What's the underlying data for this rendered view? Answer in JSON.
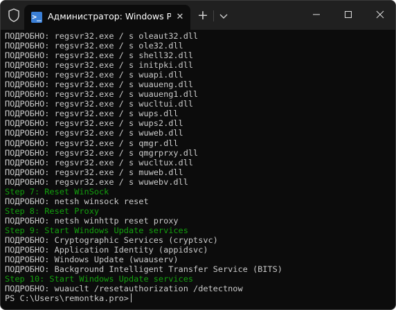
{
  "titlebar": {
    "tab_title": "Администратор: Windows Po",
    "tab_icon_glyph": ">_",
    "close_tab_glyph": "✕",
    "new_tab_glyph": "+",
    "icons": {
      "shield": "shield-icon",
      "tab": "powershell-icon",
      "dropdown": "chevron-down-icon",
      "minimize": "minimize-icon",
      "maximize": "maximize-icon",
      "close": "close-icon"
    }
  },
  "colors": {
    "background": "#0c0c0c",
    "titlebar": "#202020",
    "text": "#cccccc",
    "step_text": "#13a10e"
  },
  "terminal": {
    "lines": [
      {
        "type": "verbose",
        "text": "ПОДРОБНО: regsvr32.exe / s oleaut32.dll"
      },
      {
        "type": "verbose",
        "text": "ПОДРОБНО: regsvr32.exe / s ole32.dll"
      },
      {
        "type": "verbose",
        "text": "ПОДРОБНО: regsvr32.exe / s shell32.dll"
      },
      {
        "type": "verbose",
        "text": "ПОДРОБНО: regsvr32.exe / s initpki.dll"
      },
      {
        "type": "verbose",
        "text": "ПОДРОБНО: regsvr32.exe / s wuapi.dll"
      },
      {
        "type": "verbose",
        "text": "ПОДРОБНО: regsvr32.exe / s wuaueng.dll"
      },
      {
        "type": "verbose",
        "text": "ПОДРОБНО: regsvr32.exe / s wuaueng1.dll"
      },
      {
        "type": "verbose",
        "text": "ПОДРОБНО: regsvr32.exe / s wucltui.dll"
      },
      {
        "type": "verbose",
        "text": "ПОДРОБНО: regsvr32.exe / s wups.dll"
      },
      {
        "type": "verbose",
        "text": "ПОДРОБНО: regsvr32.exe / s wups2.dll"
      },
      {
        "type": "verbose",
        "text": "ПОДРОБНО: regsvr32.exe / s wuweb.dll"
      },
      {
        "type": "verbose",
        "text": "ПОДРОБНО: regsvr32.exe / s qmgr.dll"
      },
      {
        "type": "verbose",
        "text": "ПОДРОБНО: regsvr32.exe / s qmgrprxy.dll"
      },
      {
        "type": "verbose",
        "text": "ПОДРОБНО: regsvr32.exe / s wucltux.dll"
      },
      {
        "type": "verbose",
        "text": "ПОДРОБНО: regsvr32.exe / s muweb.dll"
      },
      {
        "type": "verbose",
        "text": "ПОДРОБНО: regsvr32.exe / s wuwebv.dll"
      },
      {
        "type": "step",
        "text": "Step 7: Reset WinSock"
      },
      {
        "type": "verbose",
        "text": "ПОДРОБНО: netsh winsock reset"
      },
      {
        "type": "step",
        "text": "Step 8: Reset Proxy"
      },
      {
        "type": "verbose",
        "text": "ПОДРОБНО: netsh winhttp reset proxy"
      },
      {
        "type": "step",
        "text": "Step 9: Start Windows Update services"
      },
      {
        "type": "verbose",
        "text": "ПОДРОБНО: Cryptographic Services (cryptsvc)"
      },
      {
        "type": "verbose",
        "text": "ПОДРОБНО: Application Identity (appidsvc)"
      },
      {
        "type": "verbose",
        "text": "ПОДРОБНО: Windows Update (wuauserv)"
      },
      {
        "type": "verbose",
        "text": "ПОДРОБНО: Background Intelligent Transfer Service (BITS)"
      },
      {
        "type": "step",
        "text": "Step 10: Start Windows Update services"
      },
      {
        "type": "verbose",
        "text": "ПОДРОБНО: wuauclt /resetauthorization /detectnow"
      }
    ],
    "prompt": "PS C:\\Users\\remontka.pro>"
  }
}
